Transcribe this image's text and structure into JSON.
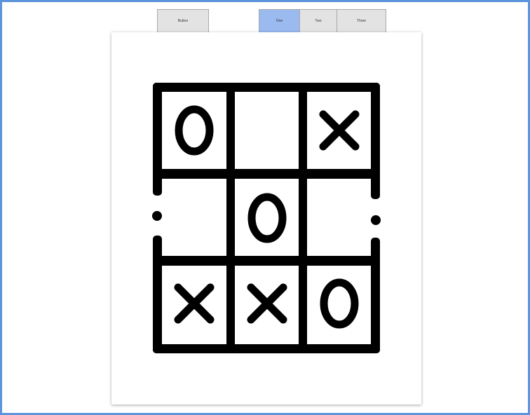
{
  "toolbar": {
    "button_label": "Button"
  },
  "segmented_control": {
    "segments": [
      {
        "label": "One",
        "selected": true
      },
      {
        "label": "Two",
        "selected": false
      },
      {
        "label": "Three",
        "selected": false
      }
    ]
  },
  "colors": {
    "window_border": "#5b93dc",
    "selected_segment": "#9bbaf0",
    "button_bg": "#e3e3e3"
  },
  "tic_tac_toe": {
    "icon": "tic-tac-toe-icon",
    "cells": [
      "O",
      "",
      "X",
      "",
      "O",
      "",
      "X",
      "X",
      "O"
    ]
  }
}
